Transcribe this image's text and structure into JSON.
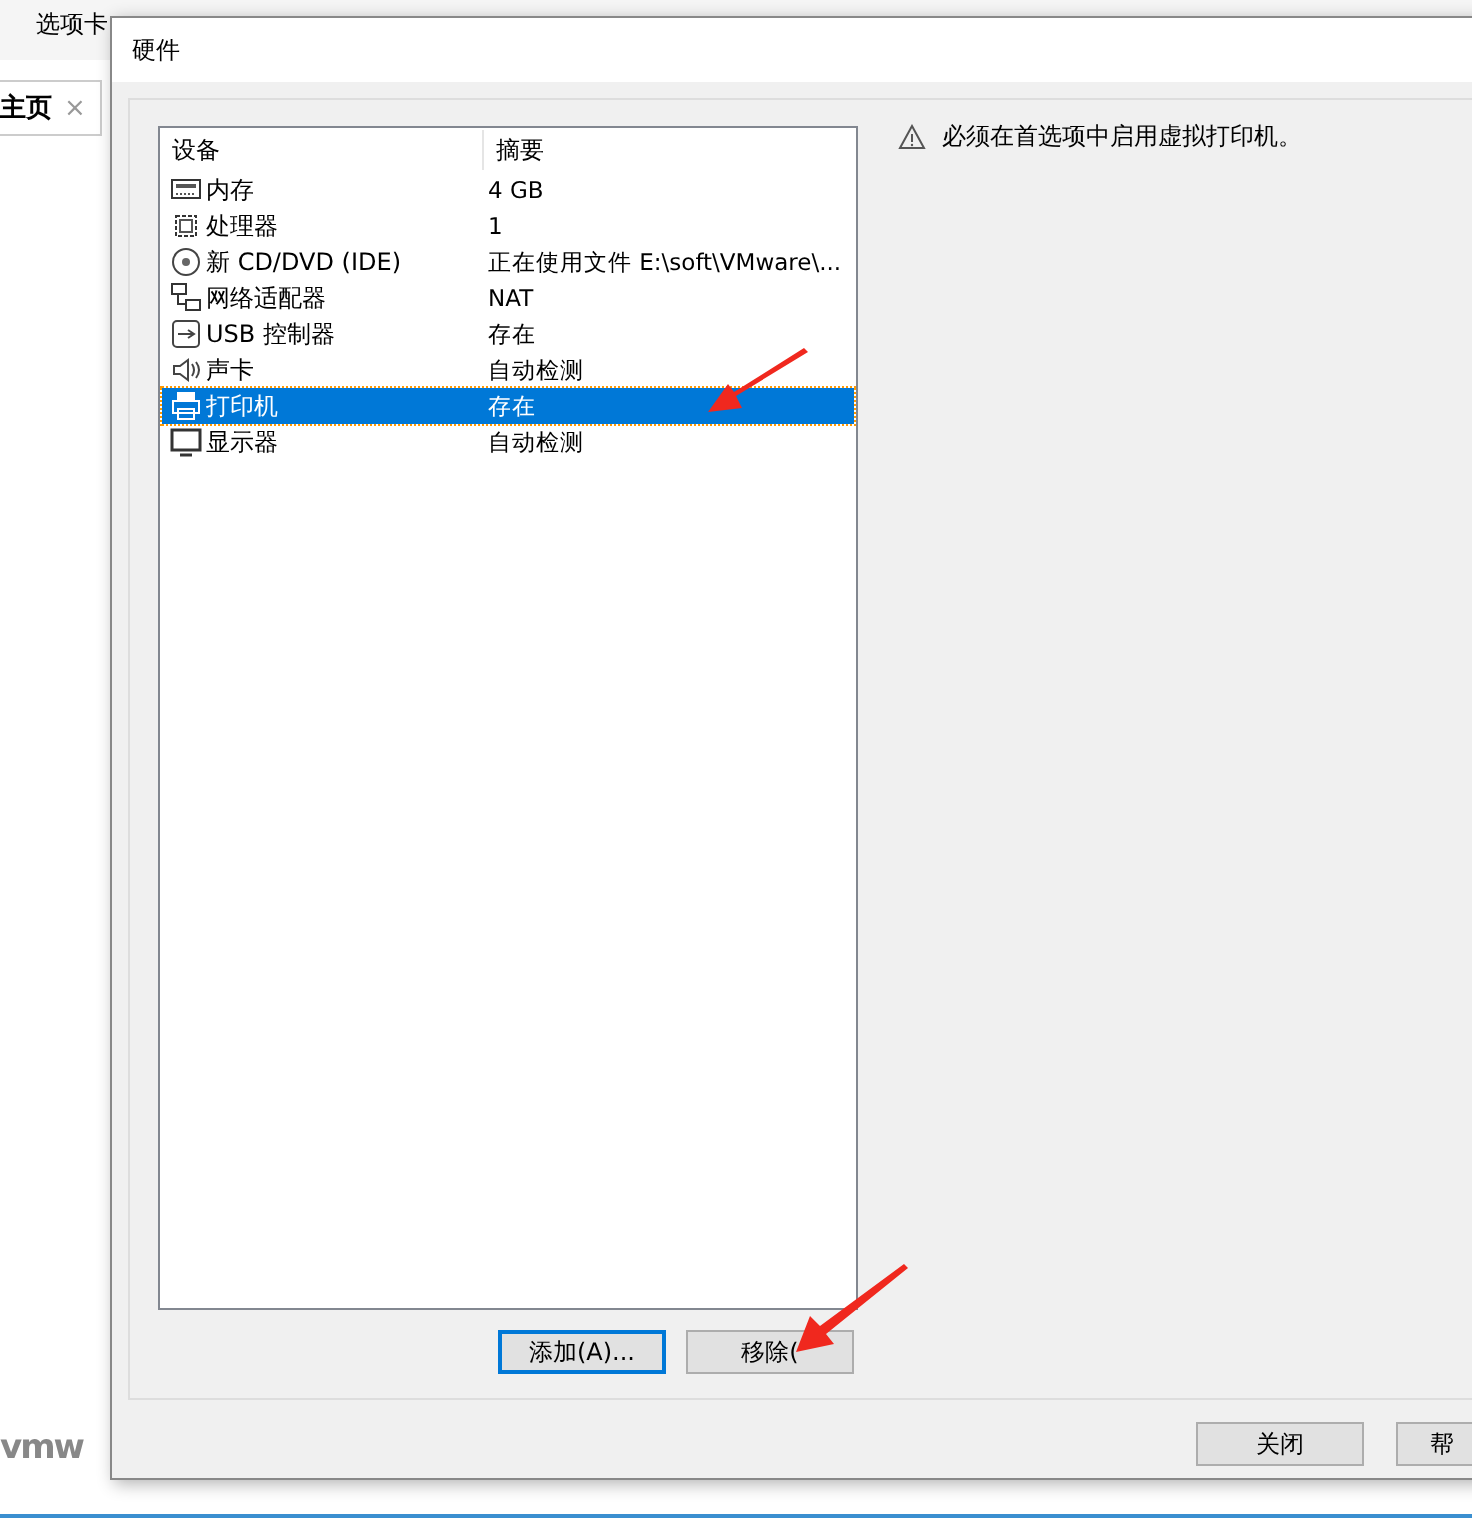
{
  "background_app": {
    "menu_item": "选项卡",
    "tab": {
      "label": "主页",
      "close": "×"
    },
    "logo": "vmw"
  },
  "dialog": {
    "title": "硬件",
    "table": {
      "columns": [
        "设备",
        "摘要"
      ],
      "rows": [
        {
          "kind": "memory",
          "device": "内存",
          "summary": "4 GB",
          "selected": false
        },
        {
          "kind": "cpu",
          "device": "处理器",
          "summary": "1",
          "selected": false
        },
        {
          "kind": "disc",
          "device": "新 CD/DVD (IDE)",
          "summary": "正在使用文件 E:\\soft\\VMware\\...",
          "selected": false
        },
        {
          "kind": "network",
          "device": "网络适配器",
          "summary": "NAT",
          "selected": false
        },
        {
          "kind": "usb",
          "device": "USB 控制器",
          "summary": "存在",
          "selected": false
        },
        {
          "kind": "sound",
          "device": "声卡",
          "summary": "自动检测",
          "selected": false
        },
        {
          "kind": "printer",
          "device": "打印机",
          "summary": "存在",
          "selected": true
        },
        {
          "kind": "display",
          "device": "显示器",
          "summary": "自动检测",
          "selected": false
        }
      ]
    },
    "notice": "必须在首选项中启用虚拟打印机。",
    "list_buttons": [
      {
        "label": "添加(A)...",
        "focused": true
      },
      {
        "label": "移除(",
        "focused": false
      }
    ],
    "footer_buttons": [
      "关闭",
      "帮"
    ]
  }
}
